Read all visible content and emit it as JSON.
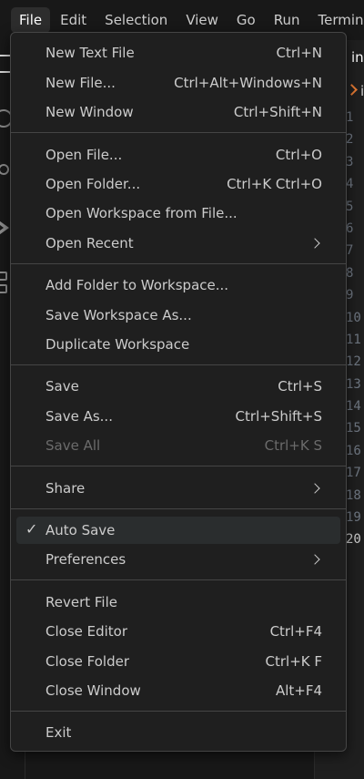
{
  "menubar": {
    "items": [
      "File",
      "Edit",
      "Selection",
      "View",
      "Go",
      "Run",
      "Terminal"
    ]
  },
  "editor": {
    "tab_label": "in",
    "breadcrumb": "i",
    "line_numbers": [
      "1",
      "2",
      "3",
      "4",
      "5",
      "6",
      "7",
      "8",
      "9",
      "10",
      "11",
      "12",
      "13",
      "14",
      "15",
      "16",
      "17",
      "18",
      "19",
      "20"
    ],
    "current_line": "20"
  },
  "file_menu": {
    "new_text_file": {
      "label": "New Text File",
      "shortcut": "Ctrl+N"
    },
    "new_file": {
      "label": "New File...",
      "shortcut": "Ctrl+Alt+Windows+N"
    },
    "new_window": {
      "label": "New Window",
      "shortcut": "Ctrl+Shift+N"
    },
    "open_file": {
      "label": "Open File...",
      "shortcut": "Ctrl+O"
    },
    "open_folder": {
      "label": "Open Folder...",
      "shortcut": "Ctrl+K Ctrl+O"
    },
    "open_workspace": {
      "label": "Open Workspace from File..."
    },
    "open_recent": {
      "label": "Open Recent"
    },
    "add_folder": {
      "label": "Add Folder to Workspace..."
    },
    "save_workspace_as": {
      "label": "Save Workspace As..."
    },
    "duplicate_workspace": {
      "label": "Duplicate Workspace"
    },
    "save": {
      "label": "Save",
      "shortcut": "Ctrl+S"
    },
    "save_as": {
      "label": "Save As...",
      "shortcut": "Ctrl+Shift+S"
    },
    "save_all": {
      "label": "Save All",
      "shortcut": "Ctrl+K S"
    },
    "share": {
      "label": "Share"
    },
    "auto_save": {
      "label": "Auto Save",
      "checked": true
    },
    "preferences": {
      "label": "Preferences"
    },
    "revert_file": {
      "label": "Revert File"
    },
    "close_editor": {
      "label": "Close Editor",
      "shortcut": "Ctrl+F4"
    },
    "close_folder": {
      "label": "Close Folder",
      "shortcut": "Ctrl+K F"
    },
    "close_window": {
      "label": "Close Window",
      "shortcut": "Alt+F4"
    },
    "exit": {
      "label": "Exit"
    }
  },
  "colors": {
    "menu_bg": "#1f1f1f",
    "menu_border": "#454545",
    "highlight": "#2a2d2e",
    "text": "#cccccc",
    "disabled_text": "#6b6b6b",
    "breadcrumb_accent": "#e37933"
  }
}
